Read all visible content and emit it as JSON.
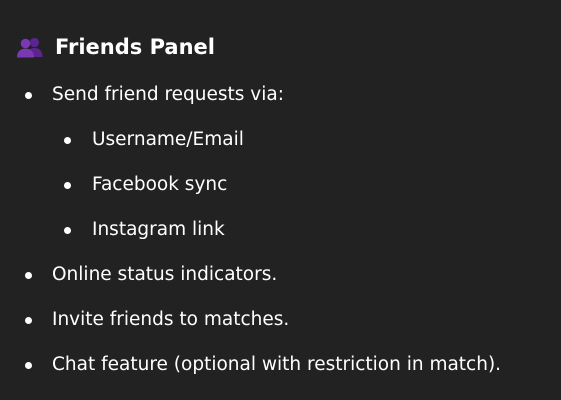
{
  "section": {
    "icon": "busts-in-silhouette-icon",
    "title": "Friends Panel"
  },
  "colors": {
    "background": "#222222",
    "text": "#ffffff",
    "icon": "#6a2fa0"
  },
  "items": [
    {
      "level": 1,
      "text": "Send friend requests via:"
    },
    {
      "level": 2,
      "text": "Username/Email"
    },
    {
      "level": 2,
      "text": "Facebook sync"
    },
    {
      "level": 2,
      "text": "Instagram link"
    },
    {
      "level": 1,
      "text": "Online status indicators."
    },
    {
      "level": 1,
      "text": "Invite friends to matches."
    },
    {
      "level": 1,
      "text": "Chat feature (optional with restriction in match)."
    }
  ]
}
